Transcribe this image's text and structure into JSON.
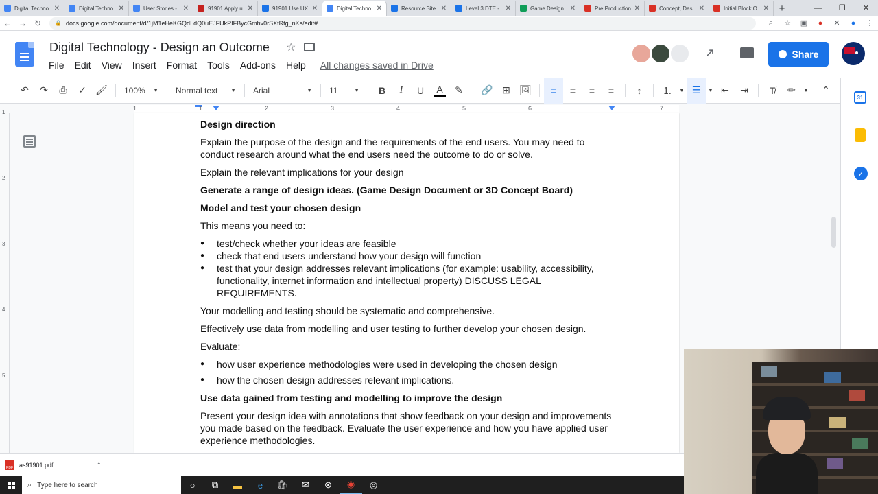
{
  "browser": {
    "tabs": [
      {
        "label": "Digital Techno",
        "color": "#4285f4",
        "active": false
      },
      {
        "label": "Digital Techno",
        "color": "#4285f4",
        "active": false
      },
      {
        "label": "User Stories -",
        "color": "#4285f4",
        "active": false
      },
      {
        "label": "91901 Apply u",
        "color": "#c5221f",
        "active": false
      },
      {
        "label": "91901 Use UX",
        "color": "#1a73e8",
        "active": false
      },
      {
        "label": "Digital Techno",
        "color": "#4285f4",
        "active": true
      },
      {
        "label": "Resource Site",
        "color": "#1a73e8",
        "active": false
      },
      {
        "label": "Level 3 DTE -",
        "color": "#1a73e8",
        "active": false
      },
      {
        "label": "Game Design",
        "color": "#0f9d58",
        "active": false
      },
      {
        "label": "Pre Production",
        "color": "#d93025",
        "active": false
      },
      {
        "label": "Concept, Desi",
        "color": "#d93025",
        "active": false
      },
      {
        "label": "Initial Block O",
        "color": "#d93025",
        "active": false
      }
    ],
    "url": "docs.google.com/document/d/1jM1eHeKGQdLdQ0uEJFUkPIFBycGmhv0rSXtRtg_nKs/edit#"
  },
  "doc": {
    "title": "Digital Technology - Design an Outcome",
    "menu": [
      "File",
      "Edit",
      "View",
      "Insert",
      "Format",
      "Tools",
      "Add-ons",
      "Help"
    ],
    "saved_status": "All changes saved in Drive",
    "share_label": "Share"
  },
  "toolbar": {
    "zoom": "100%",
    "style": "Normal text",
    "font": "Arial",
    "size": "11",
    "bold": "B",
    "italic": "I",
    "underline": "U",
    "text_color": "A"
  },
  "ruler": {
    "numbers": [
      "1",
      "1",
      "2",
      "3",
      "4",
      "5",
      "6",
      "7"
    ],
    "vnumbers": [
      "1",
      "2",
      "3",
      "4",
      "5"
    ]
  },
  "content": {
    "h1": "Design direction",
    "p1": "Explain the purpose of the design and the requirements of the end users.  You may need to conduct research around what the end users need the outcome to do or solve.",
    "p2": "Explain the relevant implications for your design",
    "h2": "Generate a range of design ideas. (Game Design Document or 3D Concept Board)",
    "h3": "Model and test your chosen design",
    "p3": "This means you need to:",
    "list1": [
      "test/check whether your ideas are feasible",
      "check that end users understand how your design will function",
      "test that your design addresses relevant implications (for example: usability, accessibility, functionality, internet information and intellectual property) DISCUSS LEGAL REQUIREMENTS."
    ],
    "p4": "Your modelling and testing should be systematic and comprehensive.",
    "p5": "Effectively use data from modelling and user testing to further develop your chosen design.",
    "p6": "Evaluate:",
    "list2": [
      "how user experience methodologies were used in developing the chosen design",
      "how the chosen design addresses relevant implications."
    ],
    "h4": "Use data gained from testing and modelling to improve the design",
    "p7": "Present your design idea with annotations that show feedback on your design and improvements you made based on the feedback.  Evaluate the user experience and how you have applied user experience methodologies."
  },
  "sidepanel": {
    "calendar_day": "31"
  },
  "downloads": {
    "file": "as91901.pdf",
    "badge": "PDF"
  },
  "taskbar": {
    "search_placeholder": "Type here to search"
  }
}
